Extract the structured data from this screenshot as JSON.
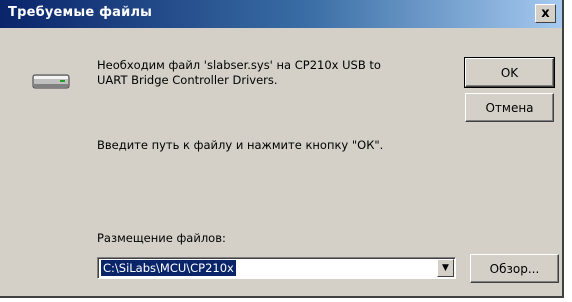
{
  "dialog": {
    "title": "Требуемые файлы",
    "close_glyph": "x",
    "message_line1": "Необходим файл 'slabser.sys' на CP210x USB to",
    "message_line2": "UART Bridge Controller Drivers.",
    "instruction": "Введите путь к файлу и нажмите кнопку \"ОК\".",
    "location_label": "Размещение файлов:",
    "location_value": "C:\\SiLabs\\MCU\\CP210x",
    "icon": "drive-icon"
  },
  "buttons": {
    "ok": "OK",
    "cancel": "Отмена",
    "browse": "Обзор..."
  },
  "colors": {
    "titlebar_start": "#0a246a",
    "titlebar_end": "#a6caf0",
    "face": "#d4d0c8",
    "selection": "#0a246a"
  }
}
